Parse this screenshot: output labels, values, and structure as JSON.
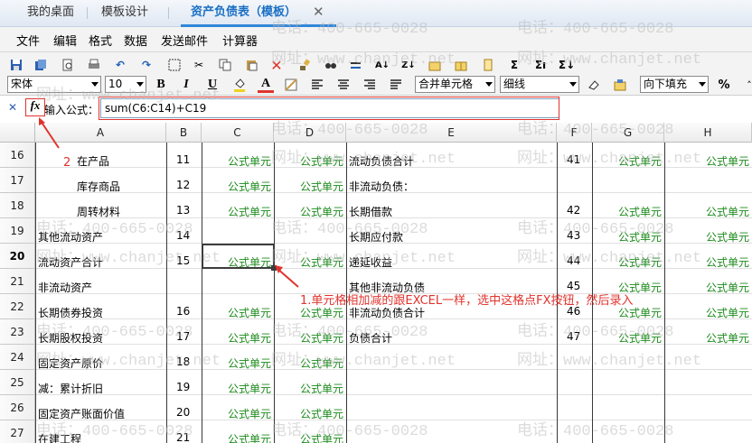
{
  "tabs": [
    {
      "label": "我的桌面",
      "active": false
    },
    {
      "label": "模板设计",
      "active": false
    },
    {
      "label": "资产负债表（模板）",
      "active": true
    }
  ],
  "menu": [
    "文件",
    "编辑",
    "格式",
    "数据",
    "发送邮件",
    "计算器"
  ],
  "toolbar": {
    "font_name": "宋体",
    "font_size": "10",
    "merge": "合并单元格",
    "border": "细线",
    "fill": "向下填充",
    "bold": "B",
    "italic": "I",
    "underline": "U",
    "color_a": "A",
    "percent": "%"
  },
  "formula": {
    "label": "输入公式：",
    "value": "sum(C6:C14)+C19",
    "fx": "fx"
  },
  "columns": [
    "A",
    "B",
    "C",
    "D",
    "E",
    "F",
    "G",
    "H"
  ],
  "formula_cell": "公式单元",
  "rows": [
    {
      "num": "16",
      "a": "在产品",
      "b": "11",
      "c": "公式单元",
      "d": "公式单元",
      "e": "流动负债合计",
      "f": "41",
      "g": "公式单元",
      "h": "公式单元"
    },
    {
      "num": "17",
      "a": "库存商品",
      "b": "12",
      "c": "公式单元",
      "d": "公式单元",
      "e": "非流动负债：",
      "f": "",
      "g": "",
      "h": ""
    },
    {
      "num": "18",
      "a": "周转材料",
      "b": "13",
      "c": "公式单元",
      "d": "公式单元",
      "e": "长期借款",
      "f": "42",
      "g": "公式单元",
      "h": "公式单元"
    },
    {
      "num": "19",
      "a": "其他流动资产",
      "b": "14",
      "c": "",
      "d": "",
      "e": "长期应付款",
      "f": "43",
      "g": "公式单元",
      "h": "公式单元"
    },
    {
      "num": "20",
      "a": "流动资产合计",
      "b": "15",
      "c": "公式单元",
      "d": "公式单元",
      "e": "递延收益",
      "f": "44",
      "g": "公式单元",
      "h": "公式单元"
    },
    {
      "num": "21",
      "a": "非流动资产",
      "b": "",
      "c": "",
      "d": "",
      "e": "其他非流动负债",
      "f": "45",
      "g": "公式单元",
      "h": "公式单元"
    },
    {
      "num": "22",
      "a": "长期债券投资",
      "b": "16",
      "c": "公式单元",
      "d": "公式单元",
      "e": "非流动负债合计",
      "f": "46",
      "g": "公式单元",
      "h": "公式单元"
    },
    {
      "num": "23",
      "a": "长期股权投资",
      "b": "17",
      "c": "公式单元",
      "d": "公式单元",
      "e": "负债合计",
      "f": "47",
      "g": "公式单元",
      "h": "公式单元"
    },
    {
      "num": "24",
      "a": "固定资产原价",
      "b": "18",
      "c": "公式单元",
      "d": "公式单元",
      "e": "",
      "f": "",
      "g": "",
      "h": ""
    },
    {
      "num": "25",
      "a": "减：累计折旧",
      "b": "19",
      "c": "公式单元",
      "d": "公式单元",
      "e": "",
      "f": "",
      "g": "",
      "h": ""
    },
    {
      "num": "26",
      "a": "固定资产账面价值",
      "b": "20",
      "c": "公式单元",
      "d": "公式单元",
      "e": "",
      "f": "",
      "g": "",
      "h": ""
    },
    {
      "num": "27",
      "a": "在建工程",
      "b": "21",
      "c": "公式单元",
      "d": "公式单元",
      "e": "",
      "f": "",
      "g": "",
      "h": ""
    }
  ],
  "annotations": {
    "one": "1.单元格相加减的跟EXCEL一样，选中这格点FX按钮，然后录入",
    "two": "2"
  },
  "watermark": {
    "phone": "电话：400-665-0028",
    "site": "网址：www.chanjet.net"
  },
  "colors": {
    "accent": "#2f86d9",
    "formula": "#1c8a1c",
    "annotation": "#e0332d"
  }
}
